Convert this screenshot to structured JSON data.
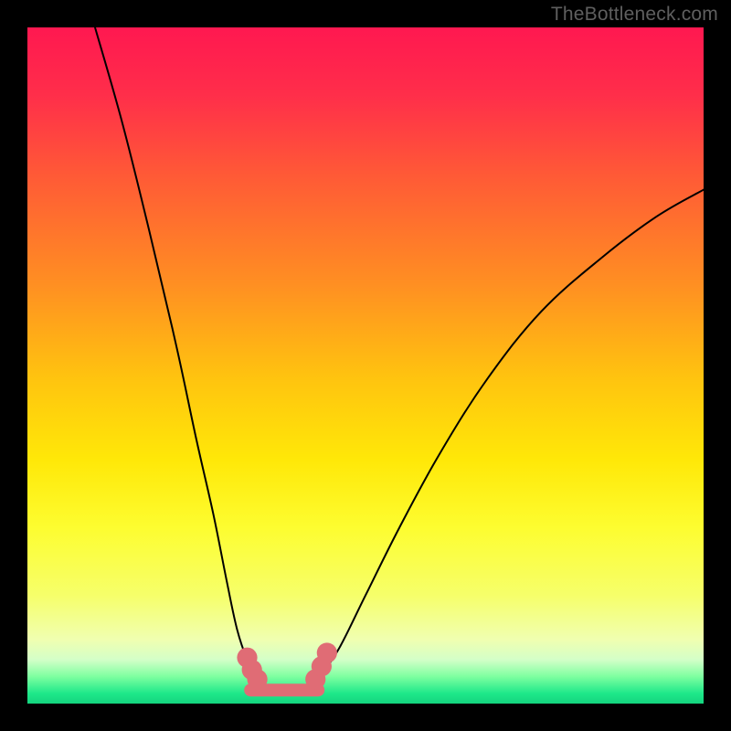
{
  "watermark": "TheBottleneck.com",
  "chart_data": {
    "type": "line",
    "title": "",
    "xlabel": "",
    "ylabel": "",
    "xlim": [
      0,
      100
    ],
    "ylim": [
      0,
      100
    ],
    "grid": false,
    "legend": false,
    "background_gradient_stops": [
      {
        "offset": 0.0,
        "color": "#ff1850"
      },
      {
        "offset": 0.1,
        "color": "#ff2e4a"
      },
      {
        "offset": 0.22,
        "color": "#ff5a36"
      },
      {
        "offset": 0.38,
        "color": "#ff8f22"
      },
      {
        "offset": 0.52,
        "color": "#ffc40f"
      },
      {
        "offset": 0.64,
        "color": "#ffe808"
      },
      {
        "offset": 0.74,
        "color": "#fdfd30"
      },
      {
        "offset": 0.84,
        "color": "#f6ff6a"
      },
      {
        "offset": 0.905,
        "color": "#f0ffb0"
      },
      {
        "offset": 0.935,
        "color": "#d4ffc8"
      },
      {
        "offset": 0.96,
        "color": "#7effa0"
      },
      {
        "offset": 0.985,
        "color": "#1ee88a"
      },
      {
        "offset": 1.0,
        "color": "#14d47e"
      }
    ],
    "series": [
      {
        "name": "left-curve",
        "color": "#000000",
        "width": 2,
        "comment": "estimated points (x,y) with y=0 bottom, y=100 top; read from pixel positions",
        "points": [
          [
            10,
            100
          ],
          [
            14,
            86
          ],
          [
            18,
            70
          ],
          [
            22,
            53
          ],
          [
            25,
            39
          ],
          [
            27.5,
            28
          ],
          [
            29.5,
            18
          ],
          [
            31,
            11
          ],
          [
            32.5,
            6.5
          ],
          [
            34,
            3.7
          ]
        ]
      },
      {
        "name": "right-curve",
        "color": "#000000",
        "width": 2,
        "comment": "estimated points (x,y)",
        "points": [
          [
            43,
            3.7
          ],
          [
            46,
            8
          ],
          [
            50,
            16
          ],
          [
            55,
            26
          ],
          [
            61,
            37
          ],
          [
            68,
            48
          ],
          [
            76,
            58
          ],
          [
            85,
            66
          ],
          [
            93,
            72
          ],
          [
            100,
            76
          ]
        ]
      },
      {
        "name": "bottom-band",
        "color": "#e06c75",
        "comment": "flat highlighted segment near y≈2, with small circular markers at the ends rising slightly",
        "y": 2,
        "x_start": 33,
        "x_end": 43,
        "marker_points": [
          [
            32.5,
            6.8
          ],
          [
            33.2,
            5.0
          ],
          [
            34.0,
            3.6
          ],
          [
            42.6,
            3.6
          ],
          [
            43.5,
            5.5
          ],
          [
            44.3,
            7.5
          ]
        ],
        "marker_radius": 1.5
      }
    ]
  }
}
